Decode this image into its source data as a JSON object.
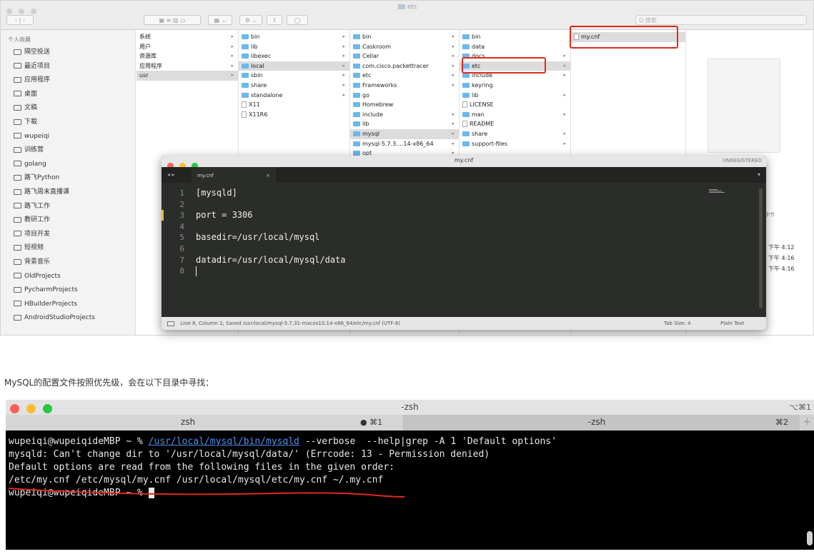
{
  "finder": {
    "window_title": "etc",
    "search_placeholder": "Q 搜索",
    "sidebar": {
      "heading": "个人收藏",
      "items": [
        "隔空投送",
        "最近项目",
        "应用程序",
        "桌面",
        "文稿",
        "下载",
        "wupeiqi",
        "训练营",
        "golang",
        "路飞Python",
        "路飞周末直播课",
        "路飞工作",
        "教研工作",
        "项目开发",
        "短视频",
        "背景音乐",
        "OldProjects",
        "PycharmProjects",
        "HBuilderProjects",
        "AndroidStudioProjects"
      ]
    },
    "col1": [
      "系统",
      "用户",
      "资源库",
      "应用程序",
      "usr"
    ],
    "col2": [
      "bin",
      "lib",
      "libexec",
      "local",
      "sbin",
      "share",
      "standalone",
      "X11",
      "X11R6"
    ],
    "col3": [
      "bin",
      "Caskroom",
      "Cellar",
      "com.cisco.packettracer",
      "etc",
      "Frameworks",
      "go",
      "Homebrew",
      "include",
      "lib",
      "mysql",
      "mysql-5.7.3....14-x86_64",
      "opt"
    ],
    "col4": [
      "bin",
      "data",
      "docs",
      "etc",
      "include",
      "keyring",
      "lib",
      "LICENSE",
      "man",
      "README",
      "share",
      "support-files"
    ],
    "col5": [
      "my.cnf"
    ],
    "preview": {
      "size_label": "字节",
      "times": [
        "下午 4:12",
        "下午 4:16",
        "下午 4:16"
      ]
    }
  },
  "sublime": {
    "window_title": "my.cnf",
    "unregistered": "UNREGISTERED",
    "tab": "my.cnf",
    "lines": [
      "[mysqld]",
      "",
      "port = 3306",
      "",
      "basedir=/usr/local/mysql",
      "",
      "datadir=/usr/local/mysql/data",
      ""
    ],
    "status_left": "Line 8, Column 1; Saved /usr/local/mysql-5.7.31-macos10.14-x86_64/etc/my.cnf (UTF-8)",
    "tab_size": "Tab Size: 4",
    "syntax": "Plain Text"
  },
  "caption": "MySQL的配置文件按照优先级，会在以下目录中寻找：",
  "terminal": {
    "window_title": "-zsh",
    "window_shortcut": "⌥⌘1",
    "tabs": [
      {
        "label": "zsh",
        "shortcut": "● ⌘1"
      },
      {
        "label": "-zsh",
        "shortcut": "⌘2"
      }
    ],
    "new_tab": "+",
    "prompt": "wupeiqi@wupeiqideMBP ~ % ",
    "command_link": "/usr/local/mysql/bin/mysqld",
    "command_rest": " --verbose  --help|grep -A 1 'Default options'",
    "output": [
      "mysqld: Can't change dir to '/usr/local/mysql/data/' (Errcode: 13 - Permission denied)",
      "Default options are read from the following files in the given order:",
      "/etc/my.cnf /etc/mysql/my.cnf /usr/local/mysql/etc/my.cnf ~/.my.cnf"
    ],
    "prompt2": "wupeiqi@wupeiqideMBP ~ % "
  },
  "colors": {
    "highlight_red": "#e0291d",
    "folder_blue": "#6bb8ef",
    "link_blue": "#4f8ff0"
  }
}
